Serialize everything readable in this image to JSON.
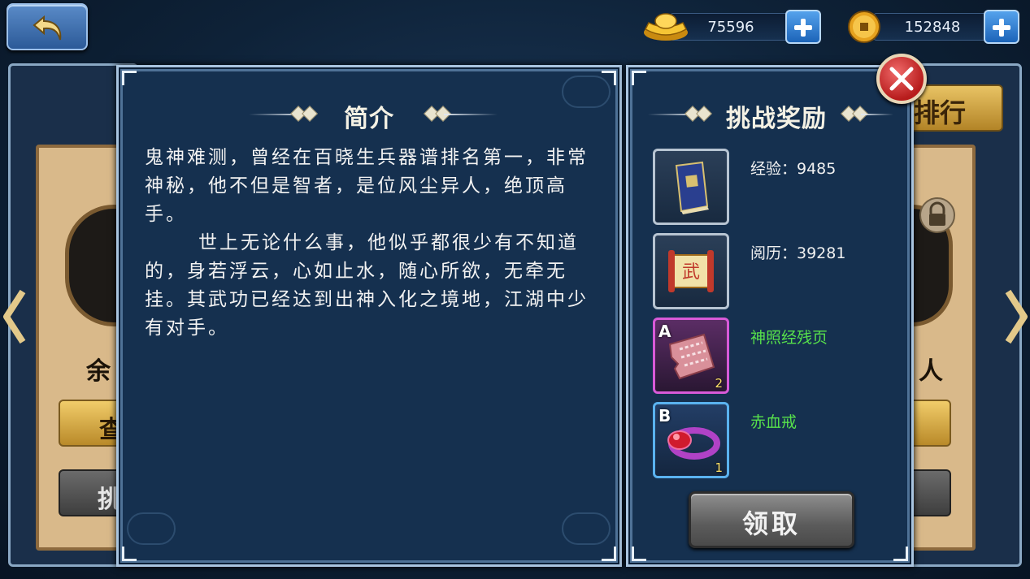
{
  "topbar": {
    "gold_value": "75596",
    "coin_value": "152848"
  },
  "background": {
    "left_name_partial": "余",
    "left_btn1_partial": "查",
    "left_btn2_partial": "挑",
    "right_name_partial": "人",
    "rank_partial": "排行"
  },
  "intro": {
    "title": "简介",
    "paragraph1": "鬼神难测，曾经在百晓生兵器谱排名第一，非常神秘，他不但是智者，是位风尘异人，绝顶高手。",
    "paragraph2": "世上无论什么事，他似乎都很少有不知道的，身若浮云，心如止水，随心所欲，无牵无挂。其武功已经达到出神入化之境地，江湖中少有对手。"
  },
  "rewards": {
    "title": "挑战奖励",
    "items": [
      {
        "label": "经验：9485",
        "grade": "",
        "count": "",
        "icon": "book-icon",
        "color": "#f0f0f0"
      },
      {
        "label": "阅历：39281",
        "grade": "",
        "count": "",
        "icon": "scroll-icon",
        "color": "#f0f0f0"
      },
      {
        "label": "神照经残页",
        "grade": "A",
        "count": "2",
        "icon": "torn-page-icon",
        "color": "#57e04b"
      },
      {
        "label": "赤血戒",
        "grade": "B",
        "count": "1",
        "icon": "ring-icon",
        "color": "#57e04b"
      }
    ],
    "claim_label": "领取"
  },
  "colors": {
    "panel_bg": "#15304f",
    "reward_green": "#57e04b",
    "grade_a_border": "#d85ad8",
    "grade_b_border": "#5ab2ef"
  }
}
